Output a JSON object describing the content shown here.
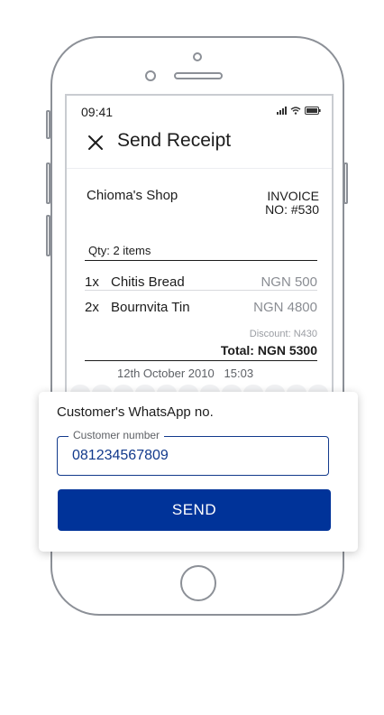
{
  "status_bar": {
    "time": "09:41"
  },
  "header": {
    "title": "Send Receipt"
  },
  "receipt": {
    "shop_name": "Chioma's Shop",
    "invoice_line1": "INVOICE",
    "invoice_line2": "NO: #530",
    "qty_label": "Qty: 2 items",
    "items": [
      {
        "qty": "1x",
        "name": "Chitis Bread",
        "price": "NGN 500"
      },
      {
        "qty": "2x",
        "name": "Bournvita Tin",
        "price": "NGN 4800"
      }
    ],
    "discount": "Discount: N430",
    "total": "Total: NGN 5300",
    "date": "12th October 2010",
    "time": "15:03"
  },
  "modal": {
    "title": "Customer's WhatsApp no.",
    "field_label": "Customer number",
    "field_value": "081234567809",
    "send_label": "SEND"
  },
  "colors": {
    "primary": "#003399",
    "frame": "#8c9097"
  }
}
